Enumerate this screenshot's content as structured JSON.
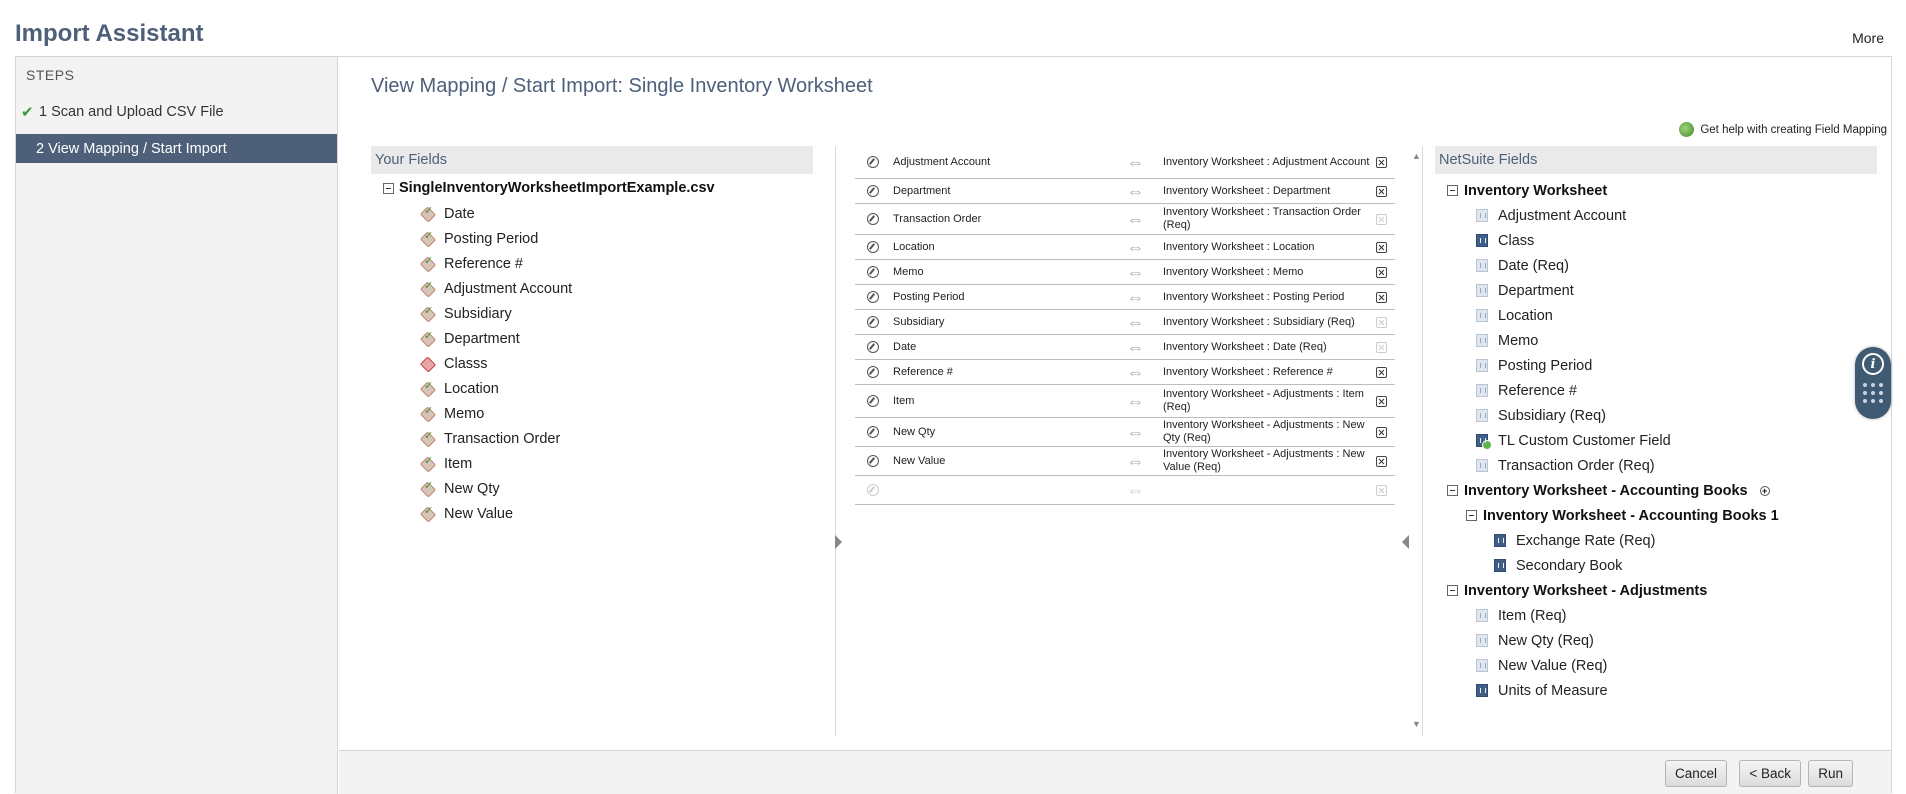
{
  "app": {
    "title": "Import Assistant",
    "more_label": "More"
  },
  "steps": {
    "header": "STEPS",
    "items": [
      {
        "label": "1 Scan and Upload CSV File",
        "done": true
      },
      {
        "label": "2 View Mapping / Start Import",
        "active": true
      }
    ]
  },
  "page": {
    "title": "View Mapping / Start Import: Single Inventory Worksheet"
  },
  "help": {
    "label": "Get help with creating Field Mapping"
  },
  "your_fields": {
    "header": "Your Fields",
    "file_name": "SingleInventoryWorksheetImportExample.csv",
    "fields": [
      {
        "label": "Date",
        "mapped": true
      },
      {
        "label": "Posting Period",
        "mapped": true
      },
      {
        "label": "Reference #",
        "mapped": true
      },
      {
        "label": "Adjustment Account",
        "mapped": true
      },
      {
        "label": "Subsidiary",
        "mapped": true
      },
      {
        "label": "Department",
        "mapped": true
      },
      {
        "label": "Classs",
        "mapped": false
      },
      {
        "label": "Location",
        "mapped": true
      },
      {
        "label": "Memo",
        "mapped": true
      },
      {
        "label": "Transaction Order",
        "mapped": true
      },
      {
        "label": "Item",
        "mapped": true
      },
      {
        "label": "New Qty",
        "mapped": true
      },
      {
        "label": "New Value",
        "mapped": true
      }
    ]
  },
  "mapping": {
    "rows": [
      {
        "source": "Adjustment Account",
        "target": "Inventory Worksheet : Adjustment Account",
        "removable": true
      },
      {
        "source": "Department",
        "target": "Inventory Worksheet : Department",
        "removable": true
      },
      {
        "source": "Transaction Order",
        "target": "Inventory Worksheet : Transaction Order (Req)",
        "removable": false
      },
      {
        "source": "Location",
        "target": "Inventory Worksheet : Location",
        "removable": true
      },
      {
        "source": "Memo",
        "target": "Inventory Worksheet : Memo",
        "removable": true
      },
      {
        "source": "Posting Period",
        "target": "Inventory Worksheet : Posting Period",
        "removable": true
      },
      {
        "source": "Subsidiary",
        "target": "Inventory Worksheet : Subsidiary (Req)",
        "removable": false
      },
      {
        "source": "Date",
        "target": "Inventory Worksheet : Date (Req)",
        "removable": false
      },
      {
        "source": "Reference #",
        "target": "Inventory Worksheet : Reference #",
        "removable": true
      },
      {
        "source": "Item",
        "target": "Inventory Worksheet - Adjustments : Item (Req)",
        "removable": true
      },
      {
        "source": "New Qty",
        "target": "Inventory Worksheet - Adjustments : New Qty (Req)",
        "removable": true
      },
      {
        "source": "New Value",
        "target": "Inventory Worksheet - Adjustments : New Value (Req)",
        "removable": true
      }
    ]
  },
  "netsuite_fields": {
    "header": "NetSuite Fields",
    "group1": {
      "label": "Inventory Worksheet",
      "fields": [
        {
          "label": "Adjustment Account",
          "icon": "field-icon"
        },
        {
          "label": "Class",
          "icon": "field-dark-icon"
        },
        {
          "label": "Date (Req)",
          "icon": "field-icon"
        },
        {
          "label": "Department",
          "icon": "field-icon"
        },
        {
          "label": "Location",
          "icon": "field-icon"
        },
        {
          "label": "Memo",
          "icon": "field-icon"
        },
        {
          "label": "Posting Period",
          "icon": "field-icon"
        },
        {
          "label": "Reference #",
          "icon": "field-icon"
        },
        {
          "label": "Subsidiary (Req)",
          "icon": "field-icon"
        },
        {
          "label": "TL Custom Customer Field",
          "icon": "custom-field-icon"
        },
        {
          "label": "Transaction Order (Req)",
          "icon": "field-icon"
        }
      ]
    },
    "group2": {
      "label": "Inventory Worksheet - Accounting Books",
      "sub_label": "Inventory Worksheet - Accounting Books 1",
      "fields": [
        {
          "label": "Exchange Rate (Req)",
          "icon": "field-dark-icon"
        },
        {
          "label": "Secondary Book",
          "icon": "field-dark-icon"
        }
      ]
    },
    "group3": {
      "label": "Inventory Worksheet - Adjustments",
      "fields": [
        {
          "label": "Item (Req)",
          "icon": "field-icon"
        },
        {
          "label": "New Qty (Req)",
          "icon": "field-icon"
        },
        {
          "label": "New Value (Req)",
          "icon": "field-icon"
        },
        {
          "label": "Units of Measure",
          "icon": "field-dark-icon"
        }
      ]
    }
  },
  "footer": {
    "cancel_label": "Cancel",
    "back_label": "< Back",
    "run_label": "Run"
  },
  "colors": {
    "accent": "#4d5f79",
    "check": "#3a9a3a"
  }
}
